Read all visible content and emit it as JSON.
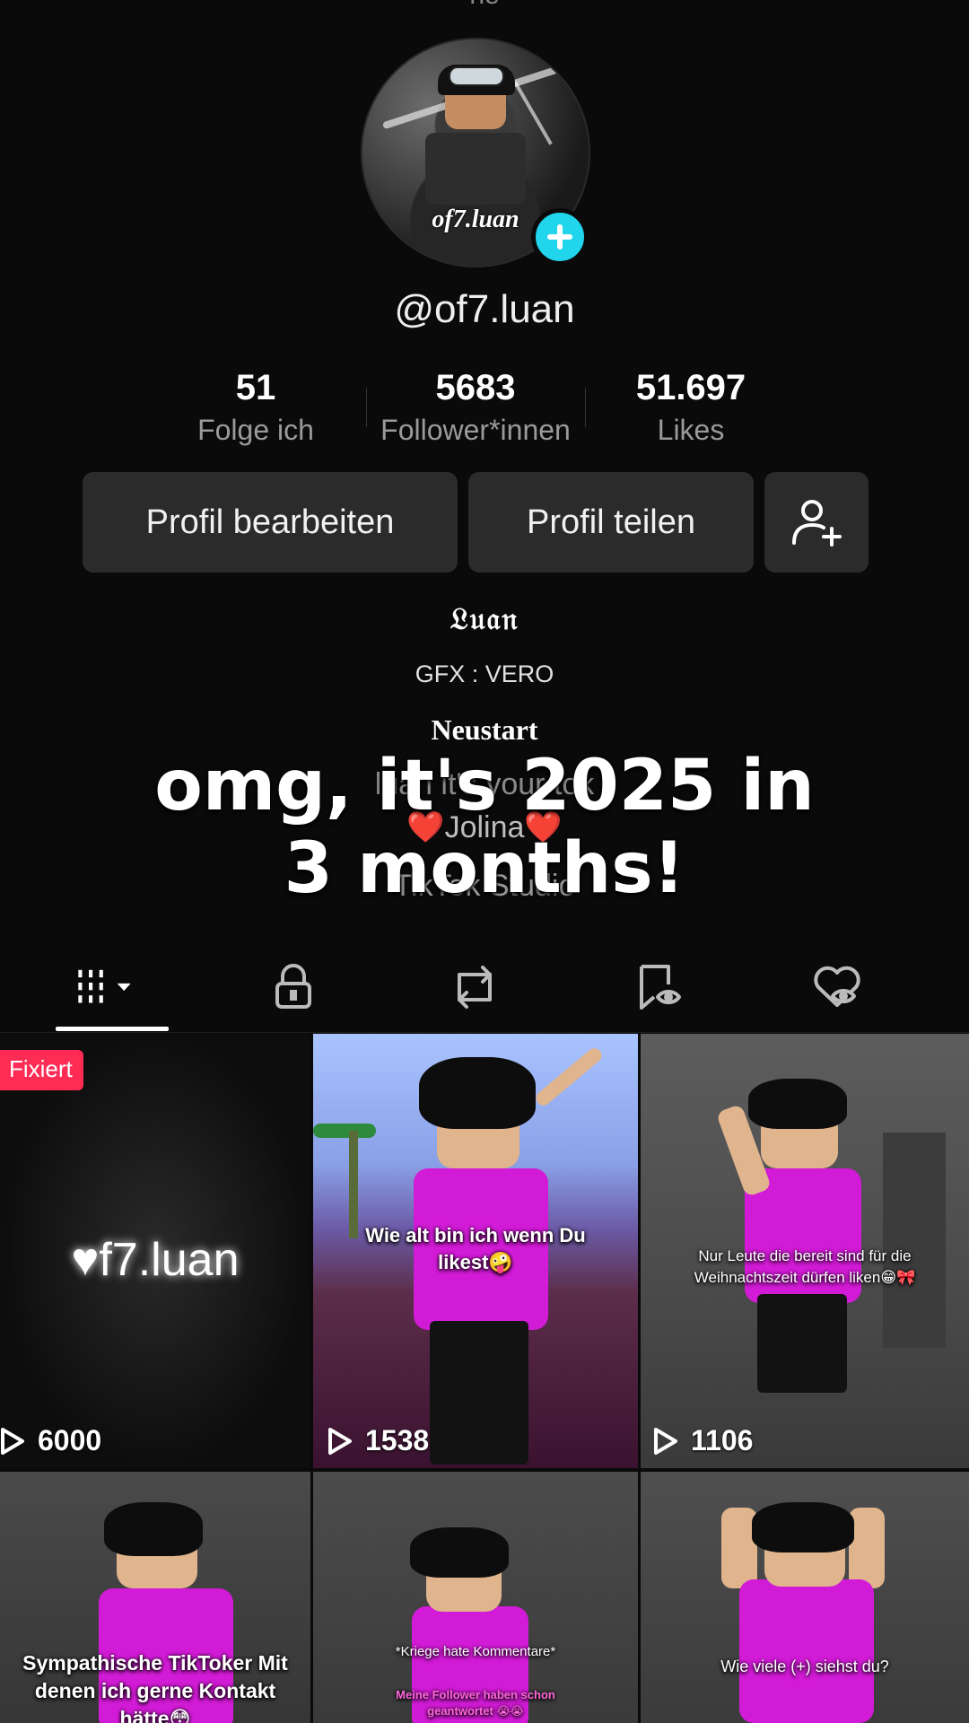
{
  "top_cut_text": "ne",
  "profile": {
    "username": "@of7.luan",
    "avatar_label": "of7.luan"
  },
  "stats": [
    {
      "value": "51",
      "label": "Folge ich"
    },
    {
      "value": "5683",
      "label": "Follower*innen"
    },
    {
      "value": "51.697",
      "label": "Likes"
    }
  ],
  "buttons": {
    "edit": "Profil bearbeiten",
    "share": "Profil teilen"
  },
  "bio": {
    "name": "𝔏𝔲𝔞𝔫",
    "gfx": "GFX : VERO",
    "neustart": "Neustart",
    "line_hidden": "luan it's your tok",
    "jolina": "❤️Jolina❤️",
    "studio": "TikTok Studio"
  },
  "overlay_text": {
    "line1": "omg, it's 2025 in",
    "line2": "3 months!"
  },
  "tabs": [
    "videos-grid-icon",
    "private-lock-icon",
    "repost-icon",
    "favorites-icon",
    "liked-icon"
  ],
  "colors": {
    "accent": "#fe2c55",
    "badge": "#20d5ec",
    "background": "#0a0a0a"
  },
  "videos": [
    {
      "pinned_label": "Fixiert",
      "title_text": "♥f7.luan",
      "views": "6000"
    },
    {
      "caption": "Wie alt bin ich wenn Du likest🤪",
      "views": "1538"
    },
    {
      "caption": "Nur Leute die bereit sind für die Weihnachtszeit dürfen liken😁🎀",
      "views": "1106"
    },
    {
      "caption": "Sympathische TikToker Mit denen ich gerne Kontakt hätte😳"
    },
    {
      "caption": "*Kriege hate Kommentare*",
      "caption2": "Meine Follower haben schon geantwortet 😭😭"
    },
    {
      "caption": "Wie viele (+) siehst du?"
    }
  ]
}
